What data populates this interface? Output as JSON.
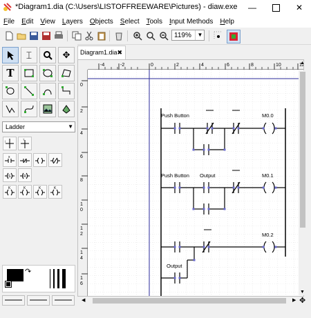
{
  "window": {
    "title": "*Diagram1.dia (C:\\Users\\LISTOFFREEWARE\\Pictures) - diaw.exe"
  },
  "menu": [
    "File",
    "Edit",
    "View",
    "Layers",
    "Objects",
    "Select",
    "Tools",
    "Input Methods",
    "Help"
  ],
  "toolbar": {
    "zoom_value": "119%"
  },
  "tab": {
    "label": "Diagram1.dia"
  },
  "sheet": {
    "selected": "Ladder"
  },
  "ruler": {
    "top_ticks": [
      "-4",
      "-2",
      "0",
      "2",
      "4",
      "6",
      "8",
      "10",
      "12"
    ],
    "left_ticks": [
      "0",
      "2",
      "4",
      "6",
      "8",
      "1\n0",
      "1\n2",
      "1\n4",
      "1\n6"
    ]
  },
  "diagram": {
    "rung1": {
      "contact1": "Push Button",
      "coil": "M0.0"
    },
    "rung2": {
      "contact1": "Push Button",
      "contact2": "Output",
      "coil": "M0.1"
    },
    "rung3": {
      "coil": "M0.2",
      "parallel": "Output"
    }
  }
}
